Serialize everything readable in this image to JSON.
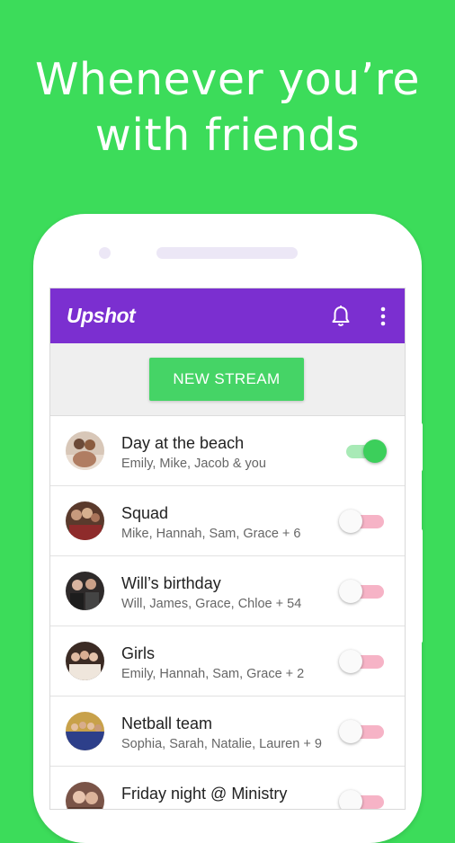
{
  "headline": {
    "line1": "Whenever you’re",
    "line2": "with friends"
  },
  "app": {
    "logo": "Upshot",
    "new_stream_label": "NEW STREAM",
    "icons": [
      "bell-icon",
      "more-vert-icon"
    ]
  },
  "colors": {
    "background": "#3cdc5a",
    "app_bar": "#7b2fd0",
    "button": "#45d466",
    "toggle_on": "#3ccf5b",
    "toggle_off_track": "#f6b3c6"
  },
  "streams": [
    {
      "title": "Day at the beach",
      "members": "Emily, Mike, Jacob & you",
      "enabled": true
    },
    {
      "title": "Squad",
      "members": "Mike, Hannah, Sam, Grace + 6",
      "enabled": false
    },
    {
      "title": "Will’s birthday",
      "members": "Will, James, Grace, Chloe + 54",
      "enabled": false
    },
    {
      "title": "Girls",
      "members": "Emily, Hannah, Sam, Grace + 2",
      "enabled": false
    },
    {
      "title": "Netball team",
      "members": "Sophia, Sarah, Natalie, Lauren + 9",
      "enabled": false
    },
    {
      "title": "Friday night @ Ministry",
      "members": "",
      "enabled": false
    }
  ]
}
